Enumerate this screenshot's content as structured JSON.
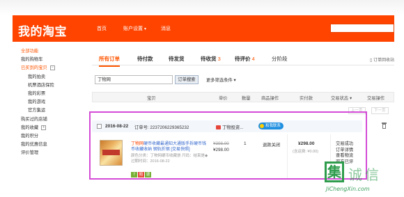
{
  "header": {
    "logo": "我的淘宝",
    "nav": [
      {
        "label": "首页",
        "caret": ""
      },
      {
        "label": "账户设置",
        "caret": "▼"
      },
      {
        "label": "消息",
        "caret": ""
      }
    ]
  },
  "sidebar": {
    "items": [
      {
        "label": "全部功能",
        "style": "orange"
      },
      {
        "label": "我的购物车",
        "style": ""
      },
      {
        "label": "已买到的宝贝",
        "style": "orange",
        "box": "−"
      },
      {
        "label": "我的拍卖",
        "style": "l2"
      },
      {
        "label": "机票酒店保险",
        "style": "l2"
      },
      {
        "label": "我的彩票",
        "style": "l2"
      },
      {
        "label": "我的游戏",
        "style": "l2"
      },
      {
        "label": "官方集运",
        "style": "l2"
      },
      {
        "label": "购买过的店铺",
        "style": ""
      },
      {
        "label": "我的收藏",
        "style": "",
        "box": "+"
      },
      {
        "label": "我的积分",
        "style": ""
      },
      {
        "label": "我的优惠信息",
        "style": ""
      },
      {
        "label": "评价管理",
        "style": ""
      }
    ]
  },
  "tabs": [
    {
      "label": "所有订单",
      "count": "",
      "active": true
    },
    {
      "label": "待付款",
      "count": "",
      "active": false
    },
    {
      "label": "待发货",
      "count": "",
      "active": false
    },
    {
      "label": "待收货",
      "count": "3",
      "active": false
    },
    {
      "label": "待评价",
      "count": "4",
      "active": false
    },
    {
      "label": "分阶段",
      "count": "",
      "active": false
    }
  ],
  "recycle_label": "订单回收站",
  "search": {
    "value": "丁物网",
    "button": "订单搜索",
    "more_filters": "更多筛选条件"
  },
  "table_headers": [
    "宝贝",
    "单价",
    "数量",
    "商品操作",
    "实付款",
    "交易状态",
    "交易操作"
  ],
  "pager": {
    "prev": "上一页",
    "next": "下一页"
  },
  "order": {
    "date": "2016-08-22",
    "order_no": "订单号: 2237206229365232",
    "shop": "丁物投资...",
    "wangwang": "和我联系",
    "product_title_prefix": "丁物网",
    "product_title": "硬币收藏最通知大通版手拆硬币钱币收藏收纳 钢轨折钢 [交易快照]",
    "product_attrs": "颜色分类：丁物网硬币收藏册 尺码：结束是◆ 过期时间：2016-08-22",
    "tags": [
      "7",
      "赔",
      "退"
    ],
    "original_price": "¥398.00",
    "price": "¥298.00",
    "quantity": "1",
    "product_action": "退款关闭",
    "total": "¥298.00",
    "shipping": "(含运费: ¥0.00)",
    "status_lines": [
      "交易成功",
      "订单详情",
      "查看物流",
      "双方已评"
    ]
  },
  "watermark": {
    "box_char": "集",
    "chars": "诚信",
    "url": "JiChengXin.com"
  },
  "colors": {
    "brand": "#ff4400",
    "accent": "#ff5500",
    "highlight_border": "#d44bd6",
    "link": "#3366cc",
    "watermark": "#2e9c4c"
  }
}
